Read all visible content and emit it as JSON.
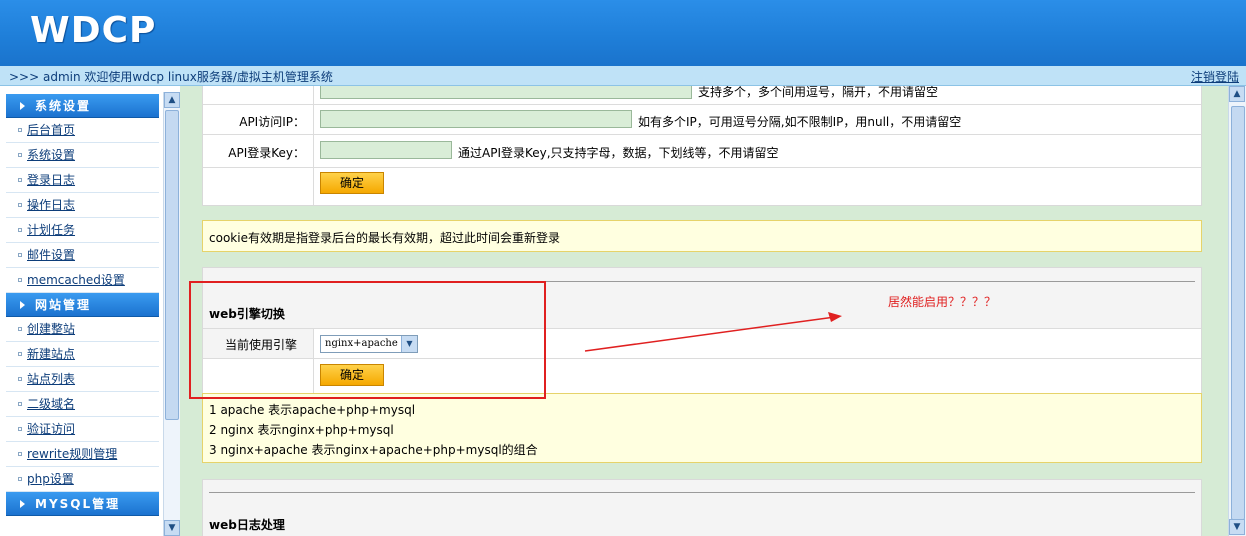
{
  "header": {
    "logo": "WDCP"
  },
  "welcome": {
    "text": ">>> admin 欢迎使用wdcp linux服务器/虚拟主机管理系统",
    "logout": "注销登陆"
  },
  "sidebar": {
    "sections": [
      {
        "title": "系统设置",
        "items": [
          "后台首页",
          "系统设置",
          "登录日志",
          "操作日志",
          "计划任务",
          "邮件设置",
          "memcached设置"
        ]
      },
      {
        "title": "网站管理",
        "items": [
          "创建整站",
          "新建站点",
          "站点列表",
          "二级域名",
          "验证访问",
          "rewrite规则管理",
          "php设置"
        ]
      },
      {
        "title": "MYSQL管理",
        "items": []
      }
    ]
  },
  "form_top": {
    "partial_row_hint": "支持多个，多个间用逗号，隔开，不用请留空",
    "api_ip_label": "API访问IP：",
    "api_ip_hint": "如有多个IP，可用逗号分隔,如不限制IP，用null，不用请留空",
    "api_key_label": "API登录Key：",
    "api_key_hint": "通过API登录Key,只支持字母，数据，下划线等，不用请留空",
    "confirm": "确定"
  },
  "cookie_note": "cookie有效期是指登录后台的最长有效期，超过此时间会重新登录",
  "engine": {
    "title": "web引擎切换",
    "label": "当前使用引擎",
    "selected": "nginx+apache",
    "confirm": "确定",
    "notes": [
      "1 apache    表示apache+php+mysql",
      "2 nginx     表示nginx+php+mysql",
      "3 nginx+apache 表示nginx+apache+php+mysql的组合"
    ]
  },
  "annotation": "居然能启用？？？？",
  "log_section": {
    "title": "web日志处理"
  },
  "colors": {
    "header": "#1f7fd9",
    "content_bg": "#d6ebd5",
    "button": "#f5a800",
    "annotation": "#e02020"
  }
}
